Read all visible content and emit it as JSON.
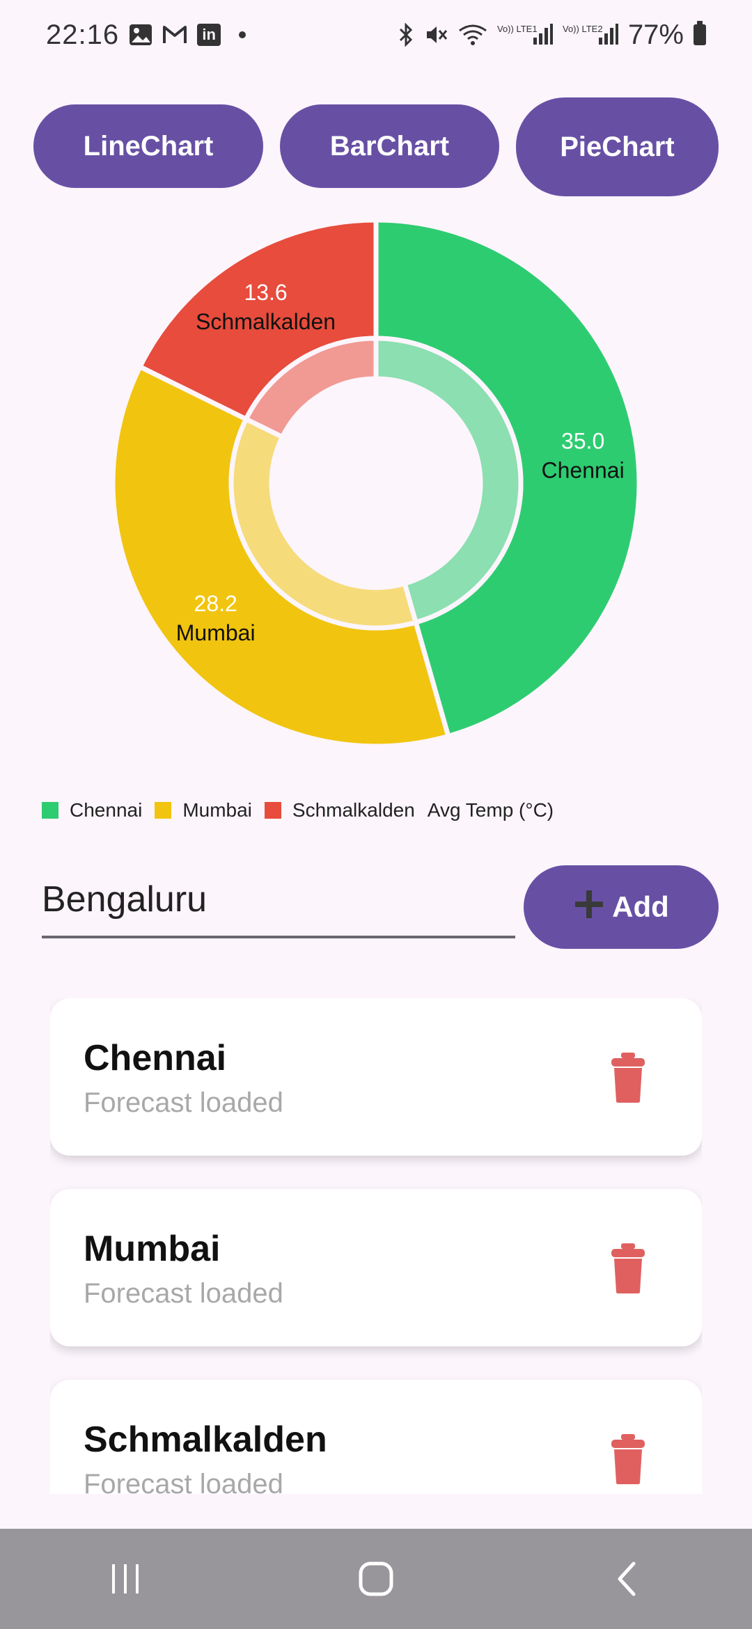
{
  "status_bar": {
    "time": "22:16",
    "battery": "77%",
    "left_icons": [
      "image-icon",
      "gmail-icon",
      "linkedin-icon",
      "notification-dot"
    ],
    "right_icons": [
      "bluetooth-icon",
      "mute-icon",
      "wifi-icon",
      "signal-lte1-icon",
      "signal-lte2-icon",
      "battery-icon"
    ],
    "linkedin_text": "in",
    "lte1_text": "Vo)) LTE1",
    "lte2_text": "Vo)) LTE2"
  },
  "chart_buttons": {
    "line": "LineChart",
    "bar": "BarChart",
    "pie": "PieChart"
  },
  "chart_data": {
    "type": "pie",
    "variant": "donut",
    "series": [
      {
        "label": "Chennai",
        "value": 35.0,
        "value_text": "35.0",
        "color": "#2ecc71"
      },
      {
        "label": "Mumbai",
        "value": 28.2,
        "value_text": "28.2",
        "color": "#f1c40f"
      },
      {
        "label": "Schmalkalden",
        "value": 13.6,
        "value_text": "13.6",
        "color": "#e74c3c"
      }
    ],
    "legend_title": "Avg Temp (°C)",
    "legend_position": "bottom-left"
  },
  "input": {
    "value": "Bengaluru",
    "add_label": "Add"
  },
  "cities": [
    {
      "name": "Chennai",
      "status": "Forecast loaded"
    },
    {
      "name": "Mumbai",
      "status": "Forecast loaded"
    },
    {
      "name": "Schmalkalden",
      "status": "Forecast loaded"
    }
  ],
  "colors": {
    "accent": "#6750a4",
    "background": "#fcf5fc",
    "delete": "#e06060",
    "nav_bar": "#99969b"
  }
}
